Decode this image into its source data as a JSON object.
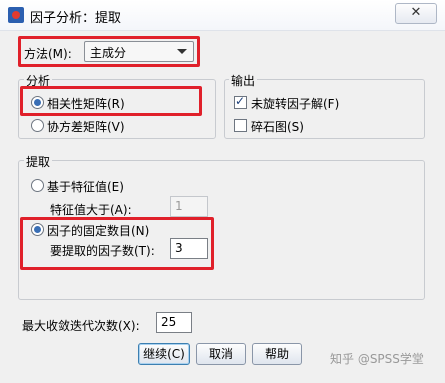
{
  "window": {
    "title": "因子分析：提取",
    "close_symbol": "✕"
  },
  "method": {
    "label": "方法(M):",
    "value": "主成分"
  },
  "analyze": {
    "legend": "分析",
    "options": [
      {
        "label": "相关性矩阵(R)",
        "checked": true
      },
      {
        "label": "协方差矩阵(V)",
        "checked": false
      }
    ]
  },
  "output": {
    "legend": "输出",
    "options": [
      {
        "label": "未旋转因子解(F)",
        "checked": true
      },
      {
        "label": "碎石图(S)",
        "checked": false
      }
    ]
  },
  "extract": {
    "legend": "提取",
    "eigen_label": "基于特征值(E)",
    "eigen_gt_label": "特征值大于(A):",
    "eigen_value": "1",
    "fixed_label": "因子的固定数目(N)",
    "fixed_count_label": "要提取的因子数(T):",
    "fixed_count_value": "3"
  },
  "iterations": {
    "label": "最大收敛迭代次数(X):",
    "value": "25"
  },
  "buttons": {
    "continue": "继续(C)",
    "cancel": "取消",
    "help": "帮助"
  },
  "watermark": "知乎 @SPSS学堂"
}
